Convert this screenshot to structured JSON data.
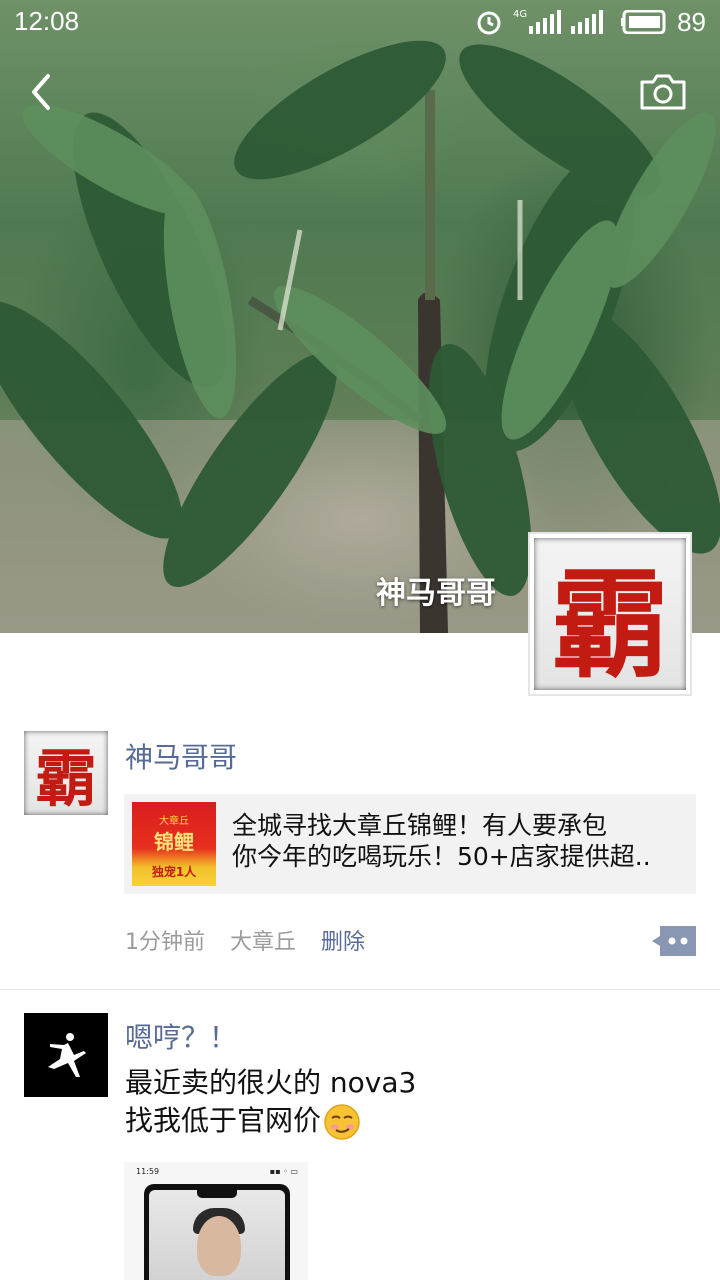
{
  "status_bar": {
    "time": "12:08",
    "network": "4G",
    "battery": "89"
  },
  "cover": {
    "username": "神马哥哥",
    "avatar_char": "霸"
  },
  "posts": [
    {
      "author": "神马哥哥",
      "avatar_char": "霸",
      "link": {
        "thumb_sub": "大章丘",
        "thumb_title": "锦鲤",
        "thumb_foot": "独宠1人",
        "line1": "全城寻找大章丘锦鲤！有人要承包",
        "line2": "你今年的吃喝玩乐！50+店家提供超.."
      },
      "time": "1分钟前",
      "location": "大章丘",
      "delete_label": "删除"
    },
    {
      "author": "嗯哼？！",
      "text_line1": "最近卖的很火的 nova3",
      "text_line2": "找我低于官网价",
      "image": {
        "status_time": "11:59"
      }
    }
  ],
  "icons": {
    "back": "chevron-left-icon",
    "camera": "camera-icon",
    "comment": "comment-dots-icon",
    "alarm": "alarm-icon",
    "signal": "signal-icon",
    "battery": "battery-icon"
  },
  "colors": {
    "link_blue": "#576b95",
    "meta_gray": "#9b9b9b",
    "card_bg": "#f2f2f2"
  }
}
